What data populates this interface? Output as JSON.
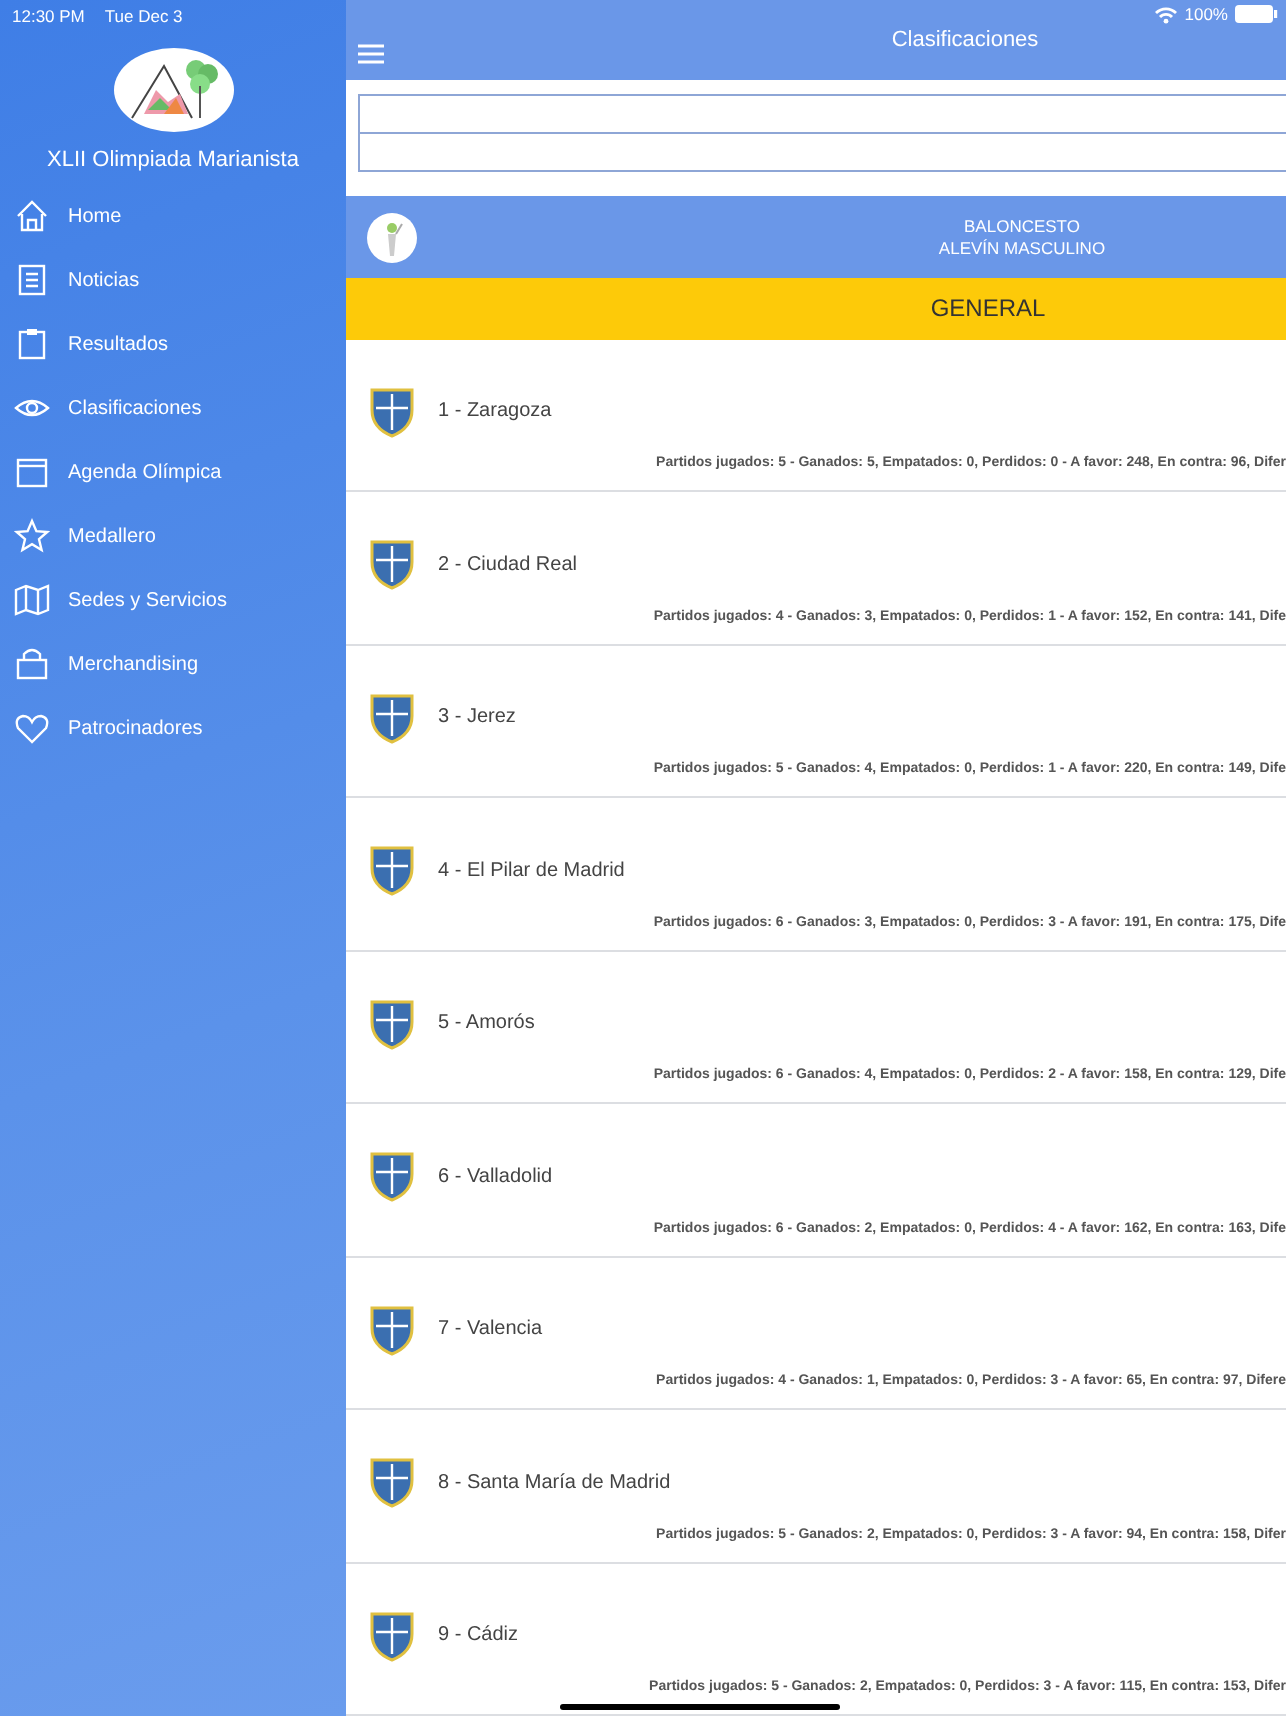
{
  "status_bar": {
    "time": "12:30 PM",
    "date": "Tue Dec 3",
    "battery": "100%"
  },
  "sidebar": {
    "title": "XLII Olimpiada Marianista",
    "items": [
      {
        "label": "Home"
      },
      {
        "label": "Noticias"
      },
      {
        "label": "Resultados"
      },
      {
        "label": "Clasificaciones"
      },
      {
        "label": "Agenda Olímpica"
      },
      {
        "label": "Medallero"
      },
      {
        "label": "Sedes y Servicios"
      },
      {
        "label": "Merchandising"
      },
      {
        "label": "Patrocinadores"
      }
    ]
  },
  "header": {
    "title": "Clasificaciones"
  },
  "competition": {
    "sport": "BALONCESTO",
    "category": "ALEVÍN MASCULINO"
  },
  "section": "GENERAL",
  "standings": [
    {
      "team": "1 - Zaragoza",
      "stats": "Partidos jugados: 5 - Ganados: 5, Empatados: 0, Perdidos: 0 - A favor: 248, En contra: 96, Difer"
    },
    {
      "team": "2 - Ciudad Real",
      "stats": "Partidos jugados: 4 - Ganados: 3, Empatados: 0, Perdidos: 1 - A favor: 152, En contra: 141, Dife"
    },
    {
      "team": "3 - Jerez",
      "stats": "Partidos jugados: 5 - Ganados: 4, Empatados: 0, Perdidos: 1 - A favor: 220, En contra: 149, Dife"
    },
    {
      "team": "4 - El Pilar de Madrid",
      "stats": "Partidos jugados: 6 - Ganados: 3, Empatados: 0, Perdidos: 3 - A favor: 191, En contra: 175, Dife"
    },
    {
      "team": "5 - Amorós",
      "stats": "Partidos jugados: 6 - Ganados: 4, Empatados: 0, Perdidos: 2 - A favor: 158, En contra: 129, Dife"
    },
    {
      "team": "6 - Valladolid",
      "stats": "Partidos jugados: 6 - Ganados: 2, Empatados: 0, Perdidos: 4 - A favor: 162, En contra: 163, Dife"
    },
    {
      "team": "7 - Valencia",
      "stats": "Partidos jugados: 4 - Ganados: 1, Empatados: 0, Perdidos: 3 - A favor: 65, En contra: 97, Difere"
    },
    {
      "team": "8 - Santa María de Madrid",
      "stats": "Partidos jugados: 5 - Ganados: 2, Empatados: 0, Perdidos: 3 - A favor: 94, En contra: 158, Difer"
    },
    {
      "team": "9 - Cádiz",
      "stats": "Partidos jugados: 5 - Ganados: 2, Empatados: 0, Perdidos: 3 - A favor: 115, En contra: 153, Difer"
    }
  ]
}
